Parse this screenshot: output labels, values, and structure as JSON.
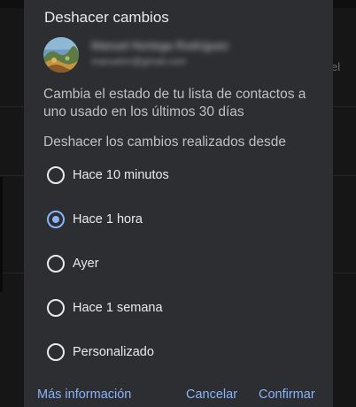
{
  "background": {
    "peek_text": "el"
  },
  "dialog": {
    "title": "Deshacer cambios",
    "account": {
      "name": "Manuel Noriega Rodríguez",
      "email": "manuelnr@gmail.com"
    },
    "description": "Cambia el estado de tu lista de contactos a uno usado en los últimos 30 días",
    "subheading": "Deshacer los cambios realizados desde",
    "options": [
      {
        "label": "Hace 10 minutos",
        "selected": false
      },
      {
        "label": "Hace 1 hora",
        "selected": true
      },
      {
        "label": "Ayer",
        "selected": false
      },
      {
        "label": "Hace 1 semana",
        "selected": false
      },
      {
        "label": "Personalizado",
        "selected": false
      }
    ],
    "actions": {
      "more_info": "Más información",
      "cancel": "Cancelar",
      "confirm": "Confirmar"
    }
  },
  "colors": {
    "accent": "#8ab4f8",
    "dialog_bg": "#2d2e31",
    "text_primary": "#e8eaed",
    "text_secondary": "#bdc1c6"
  }
}
